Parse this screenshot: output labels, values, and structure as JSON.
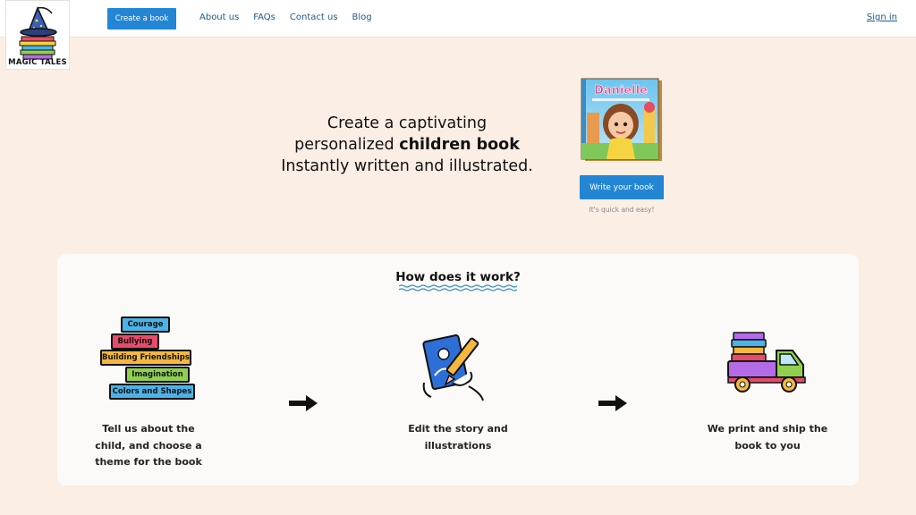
{
  "header": {
    "logo_text": "MAGIC TALES",
    "create_button": "Create a book",
    "nav": [
      "About us",
      "FAQs",
      "Contact us",
      "Blog"
    ],
    "signin": "Sign in"
  },
  "hero": {
    "line1": "Create a captivating",
    "line2_prefix": "personalized ",
    "line2_bold": "children book",
    "line3": "Instantly written and illustrated.",
    "book_title": "Danielle",
    "write_button": "Write your book",
    "note": "It's quick and easy!"
  },
  "how": {
    "title": "How does it work?",
    "themes": [
      "Courage",
      "Bullying",
      "Building Friendships",
      "Imagination",
      "Colors and Shapes"
    ],
    "steps": [
      {
        "text": "Tell us about the child, and choose a theme for the book"
      },
      {
        "text": "Edit the story and illustrations"
      },
      {
        "text": "We print and ship the book to you"
      }
    ]
  },
  "colors": {
    "primary_button": "#2386d4",
    "background": "#fbeee4",
    "link": "#1a5a8e"
  }
}
